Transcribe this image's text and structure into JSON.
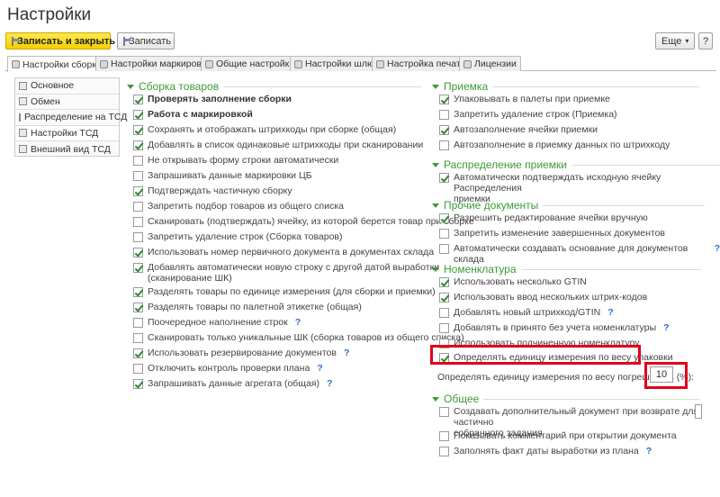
{
  "window": {
    "title": "Настройки"
  },
  "toolbar": {
    "save_close_label": "Записать и закрыть",
    "save_label": "Записать",
    "more_label": "Еще",
    "help_label": "?"
  },
  "tabs": [
    {
      "label": "Настройки сборки",
      "active": true
    },
    {
      "label": "Настройки маркировки"
    },
    {
      "label": "Общие настройки"
    },
    {
      "label": "Настройки шлюз"
    },
    {
      "label": "Настройка печати"
    },
    {
      "label": "Лицензии"
    }
  ],
  "nav": [
    {
      "label": "Основное"
    },
    {
      "label": "Обмен"
    },
    {
      "label": "Распределение на ТСД"
    },
    {
      "label": "Настройки ТСД",
      "selected": true
    },
    {
      "label": "Внешний вид ТСД"
    }
  ],
  "assembly": {
    "title": "Сборка товаров",
    "items": [
      {
        "label": "Проверять заполнение сборки",
        "checked": true,
        "bold": true
      },
      {
        "label": "Работа с маркировкой",
        "checked": true,
        "bold": true
      },
      {
        "label": "Сохранять  и отображать штрихкоды при сборке (общая)",
        "checked": true
      },
      {
        "label": "Добавлять в список одинаковые штрихкоды при сканировании",
        "checked": true
      },
      {
        "label": "Не открывать форму строки автоматически",
        "checked": false
      },
      {
        "label": "Запрашивать данные маркировки ЦБ",
        "checked": false
      },
      {
        "label": "Подтверждать частичную сборку",
        "checked": true
      },
      {
        "label": "Запретить подбор товаров из общего списка",
        "checked": false
      },
      {
        "label": "Сканировать (подтверждать) ячейку, из которой берется товар при сборке",
        "checked": false
      },
      {
        "label": "Запретить удаление строк (Сборка товаров)",
        "checked": false
      },
      {
        "label": "Использовать номер первичного документа в документах склада",
        "checked": true
      },
      {
        "label": "Добавлять автоматически новую строку с другой датой выработки",
        "label2": "(сканирование ШК)",
        "checked": true
      },
      {
        "label": "Разделять товары по единице измерения (для сборки и приемки)",
        "checked": true
      },
      {
        "label": "Разделять товары по палетной этикетке (общая)",
        "checked": true
      },
      {
        "label": "Поочередное наполнение строк",
        "checked": false,
        "help": "?"
      },
      {
        "label": "Сканировать только уникальные ШК (сборка товаров из общего списка)",
        "checked": false
      },
      {
        "label": "Использовать резервирование документов",
        "checked": true,
        "help": "?"
      },
      {
        "label": "Отключить контроль проверки плана",
        "checked": false,
        "help": "?"
      },
      {
        "label": "Запрашивать данные агрегата (общая)",
        "checked": true,
        "help": "?"
      }
    ]
  },
  "receiving": {
    "title": "Приемка",
    "items": [
      {
        "label": "Упаковывать в палеты при приемке",
        "checked": true
      },
      {
        "label": "Запретить удаление строк (Приемка)",
        "checked": false
      },
      {
        "label": "Автозаполнение ячейки приемки",
        "checked": true
      },
      {
        "label": "Автозаполнение в приемку данных по штрихкоду",
        "checked": false
      }
    ]
  },
  "distribution": {
    "title": "Распределение приемки",
    "items": [
      {
        "label": "Автоматически подтверждать исходную ячейку Распределения",
        "label2": "приемки",
        "checked": true
      }
    ]
  },
  "other_docs": {
    "title": "Прочие документы",
    "items": [
      {
        "label": "Разрешить редактирование ячейки вручную",
        "checked": true
      },
      {
        "label": "Запретить изменение завершенных документов",
        "checked": false
      },
      {
        "label": "Автоматически создавать основание для документов склада",
        "checked": false,
        "help": "?"
      }
    ]
  },
  "nomenclature": {
    "title": "Номенклатура",
    "items": [
      {
        "label": "Использовать несколько GTIN",
        "checked": true
      },
      {
        "label": "Использовать ввод нескольких штрих-кодов",
        "checked": true
      },
      {
        "label": "Добавлять новый штрихкод/GTIN",
        "checked": false,
        "help": "?"
      },
      {
        "label": "Добавлять в принято без учета номенклатуры",
        "checked": false,
        "help": "?"
      },
      {
        "label": "Использовать подчиненную номенклатуру",
        "checked": false
      },
      {
        "label": "Определять единицу измерения по весу упаковки",
        "checked": true
      }
    ],
    "tolerance_label": "Определять единицу измерения по весу погрешность (%):",
    "tolerance_value": "10"
  },
  "general": {
    "title": "Общее",
    "items": [
      {
        "label": "Создавать дополнительный документ при возврате для частично",
        "label2": "собранного задания",
        "checked": false
      },
      {
        "label": "Показывать комментарий при открытии документа",
        "checked": false
      },
      {
        "label": "Заполнять факт даты выработки из плана",
        "checked": false,
        "help": "?"
      }
    ]
  }
}
